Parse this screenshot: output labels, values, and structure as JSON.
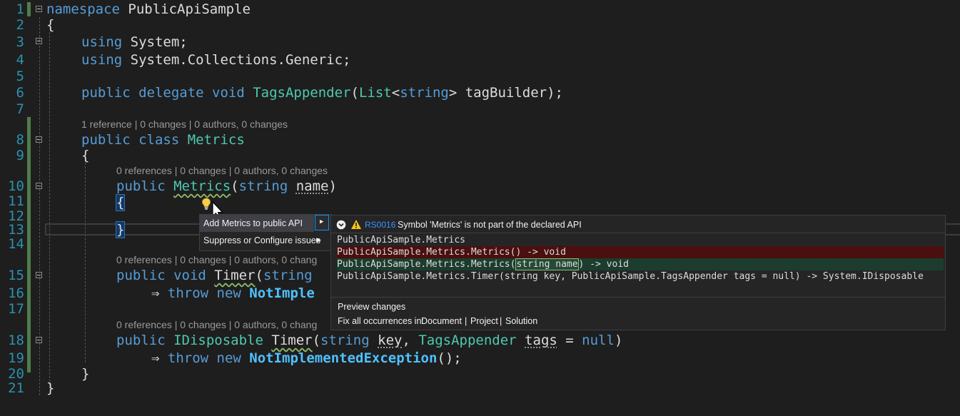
{
  "lines": {
    "n1": "1",
    "n2": "2",
    "n3": "3",
    "n4": "4",
    "n5": "5",
    "n6": "6",
    "n7": "7",
    "n8": "8",
    "n9": "9",
    "n10": "10",
    "n11": "11",
    "n12": "12",
    "n13": "13",
    "n14": "14",
    "n15": "15",
    "n16": "16",
    "n17": "17",
    "n18": "18",
    "n19": "19",
    "n20": "20",
    "n21": "21"
  },
  "code": {
    "l1_kw": "namespace",
    "l1_name": " PublicApiSample",
    "l2": "{",
    "l3_kw": "using",
    "l3_rest": " System;",
    "l4_kw": "using",
    "l4_rest": " System.Collections.Generic;",
    "l6_kw1": "public",
    "l6_kw2": " delegate",
    "l6_kw3": " void",
    "l6_name": " TagsAppender",
    "l6_p1": "(",
    "l6_list": "List",
    "l6_lt": "<",
    "l6_str": "string",
    "l6_rest": "> tagBuilder);",
    "l8_kw1": "public",
    "l8_kw2": " class",
    "l8_name": " Metrics",
    "l9": "{",
    "l10_kw": "public",
    "l10_name": "Metrics",
    "l10_p": "(",
    "l10_str": "string",
    "l10_param": "name",
    "l10_end": ")",
    "l11": "{",
    "l13": "}",
    "l15_kw1": "public",
    "l15_kw2": " void",
    "l15_name": "Timer",
    "l15_p": "(",
    "l15_str": "string",
    "l16_arrow": "⇒",
    "l16_kw": " throw",
    "l16_kw2": " new",
    "l16_ex": " NotImple",
    "l18_kw": "public",
    "l18_ty": " IDisposable",
    "l18_name": "Timer",
    "l18_p": "(",
    "l18_str": "string",
    "l18_key": "key",
    "l18_comma": ", ",
    "l18_ty2": "TagsAppender",
    "l18_tags": "tags",
    "l18_eq": " = ",
    "l18_null": "null",
    "l18_end": ")",
    "l19_arrow": "⇒",
    "l19_kw": " throw",
    "l19_kw2": " new",
    "l19_ex": " NotImplementedException",
    "l19_end": "();",
    "l20": "}",
    "l21": "}"
  },
  "codelens": {
    "c1": "1 reference | 0 changes | 0 authors, 0 changes",
    "c2": "0 references | 0 changes | 0 authors, 0 changes",
    "c3": "0 references | 0 changes | 0 authors, 0 chang",
    "c4": "0 references | 0 changes | 0 authors, 0 chang"
  },
  "quick_actions": {
    "item1": "Add Metrics to public API",
    "item2": "Suppress or Configure issues"
  },
  "preview": {
    "code_id": "RS0016",
    "message": "Symbol 'Metrics' is not part of the declared API",
    "p1": "PublicApiSample.Metrics",
    "p2": "PublicApiSample.Metrics.Metrics() -> void",
    "p3a": "PublicApiSample.Metrics.Metrics(",
    "p3b": "string name",
    "p3c": ") -> void",
    "p4": "PublicApiSample.Metrics.Timer(string key, PublicApiSample.TagsAppender tags = null) -> System.IDisposable",
    "preview_changes": "Preview changes",
    "fix_all": "Fix all occurrences in:",
    "document": "Document",
    "project": "Project",
    "solution": "Solution",
    "sep": "|"
  },
  "colors": {
    "background": "#1e1e1e",
    "keyword": "#569cd6",
    "type": "#4ec9b0",
    "line_number": "#2b91af",
    "deleted": "#4b0f0f",
    "added": "#1c3d2d",
    "link": "#3794ff"
  }
}
